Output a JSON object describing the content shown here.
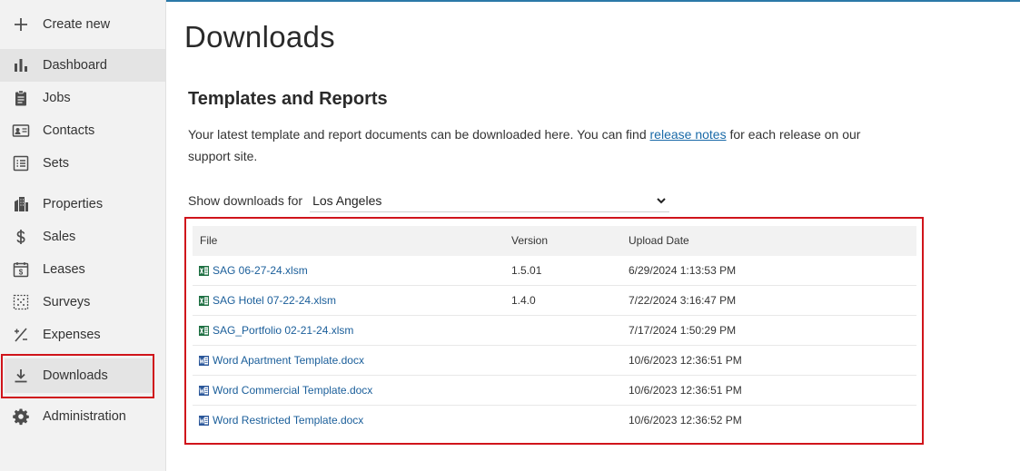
{
  "sidebar": {
    "items": [
      {
        "label": "Create new",
        "icon": "plus-icon"
      },
      {
        "label": "Dashboard",
        "icon": "bar-chart-icon"
      },
      {
        "label": "Jobs",
        "icon": "clipboard-icon"
      },
      {
        "label": "Contacts",
        "icon": "contact-card-icon"
      },
      {
        "label": "Sets",
        "icon": "list-icon"
      },
      {
        "label": "Properties",
        "icon": "building-icon"
      },
      {
        "label": "Sales",
        "icon": "dollar-icon"
      },
      {
        "label": "Leases",
        "icon": "calendar-dollar-icon"
      },
      {
        "label": "Surveys",
        "icon": "grid-dots-icon"
      },
      {
        "label": "Expenses",
        "icon": "percent-icon"
      },
      {
        "label": "Downloads",
        "icon": "download-icon"
      },
      {
        "label": "Administration",
        "icon": "gear-icon"
      }
    ],
    "active": "Dashboard"
  },
  "main": {
    "title": "Downloads",
    "section_title": "Templates and Reports",
    "description_before": "Your latest template and report documents can be downloaded here. You can find ",
    "description_link": "release notes",
    "description_after": " for each release on our support site.",
    "filter_label": "Show downloads for",
    "filter_value": "Los Angeles",
    "table": {
      "headers": [
        "File",
        "Version",
        "Upload Date"
      ],
      "rows": [
        {
          "file": "SAG 06-27-24.xlsm",
          "type": "excel",
          "version": "1.5.01",
          "date": "6/29/2024 1:13:53 PM"
        },
        {
          "file": "SAG Hotel 07-22-24.xlsm",
          "type": "excel",
          "version": "1.4.0",
          "date": "7/22/2024 3:16:47 PM"
        },
        {
          "file": "SAG_Portfolio 02-21-24.xlsm",
          "type": "excel",
          "version": "",
          "date": "7/17/2024 1:50:29 PM"
        },
        {
          "file": "Word Apartment Template.docx",
          "type": "word",
          "version": "",
          "date": "10/6/2023 12:36:51 PM"
        },
        {
          "file": "Word Commercial Template.docx",
          "type": "word",
          "version": "",
          "date": "10/6/2023 12:36:51 PM"
        },
        {
          "file": "Word Restricted Template.docx",
          "type": "word",
          "version": "",
          "date": "10/6/2023 12:36:52 PM"
        }
      ]
    }
  },
  "colors": {
    "highlight": "#d0141b",
    "link": "#1a5e9a",
    "excel": "#1d6f42",
    "word": "#2b579a"
  }
}
